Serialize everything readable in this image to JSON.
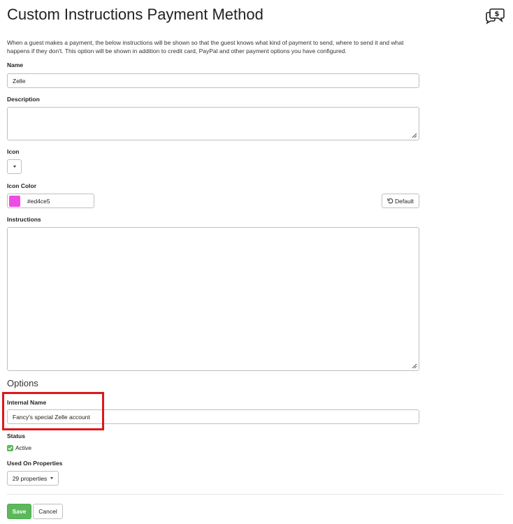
{
  "page": {
    "title": "Custom Instructions Payment Method",
    "description": "When a guest makes a payment, the below instructions will be shown so that the guest knows what kind of payment to send, where to send it and what happens if they don't. This option will be shown in addition to credit card, PayPal and other payment options you have configured.",
    "header_icon": "chat-dollar-icon"
  },
  "form": {
    "name": {
      "label": "Name",
      "value": "Zelle"
    },
    "description": {
      "label": "Description",
      "value": ""
    },
    "icon": {
      "label": "Icon"
    },
    "icon_color": {
      "label": "Icon Color",
      "value": "#ed4ce5",
      "swatch": "#ed4ce5",
      "default_button": "Default"
    },
    "instructions": {
      "label": "Instructions",
      "value": ""
    }
  },
  "options": {
    "heading": "Options",
    "internal_name": {
      "label": "Internal Name",
      "value": "Fancy's special Zelle account"
    },
    "status": {
      "label": "Status",
      "active_label": "Active",
      "checked": true
    },
    "used_on": {
      "label": "Used On Properties",
      "value": "29 properties"
    }
  },
  "actions": {
    "save": "Save",
    "cancel": "Cancel"
  },
  "colors": {
    "accent_green": "#5cb85c",
    "highlight_red": "#e0161b"
  }
}
